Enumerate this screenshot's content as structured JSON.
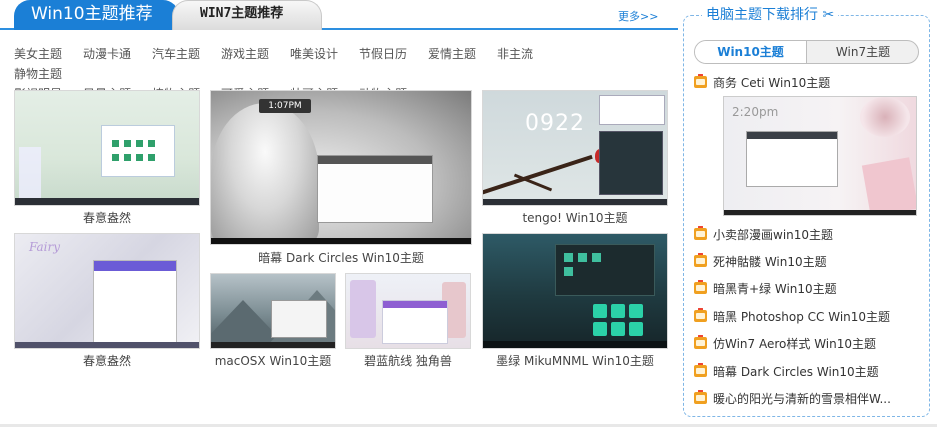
{
  "tabs": {
    "active_label": "Win10主题推荐",
    "inactive_label": "WIN7主题推荐",
    "more_label": "更多>>"
  },
  "categories": [
    "美女主题",
    "动漫卡通",
    "汽车主题",
    "游戏主题",
    "唯美设计",
    "节假日历",
    "爱情主题",
    "非主流",
    "静物主题",
    "影视明星",
    "风景主题",
    "植物主题",
    "可爱主题",
    "帅哥主题",
    "动物主题"
  ],
  "thumbnails": [
    {
      "caption": "春意盎然"
    },
    {
      "caption": "暗幕 Dark Circles Win10主题",
      "clock": "1:07PM"
    },
    {
      "caption": "tengo! Win10主题",
      "clock": "0922"
    },
    {
      "caption": "春意盎然",
      "logo": "Fairy"
    },
    {
      "caption": "macOSX Win10主题"
    },
    {
      "caption": "碧蓝航线 独角兽"
    },
    {
      "caption": "墨绿 MikuMNML Win10主题"
    }
  ],
  "ranking": {
    "title": "电脑主题下载排行",
    "tab_active": "Win10主题",
    "tab_other": "Win7主题",
    "featured_time": "2:20pm",
    "items": [
      "商务 Ceti Win10主题",
      "小卖部漫画win10主题",
      "死神骷髅 Win10主题",
      "暗黑青+绿 Win10主题",
      "暗黑 Photoshop CC Win10主题",
      "仿Win7 Aero样式 Win10主题",
      "暗幕 Dark Circles Win10主题",
      "暖心的阳光与清新的雪景相伴W..."
    ]
  },
  "colors": {
    "accent": "#1b7fd6",
    "border": "#7fb6e6"
  }
}
